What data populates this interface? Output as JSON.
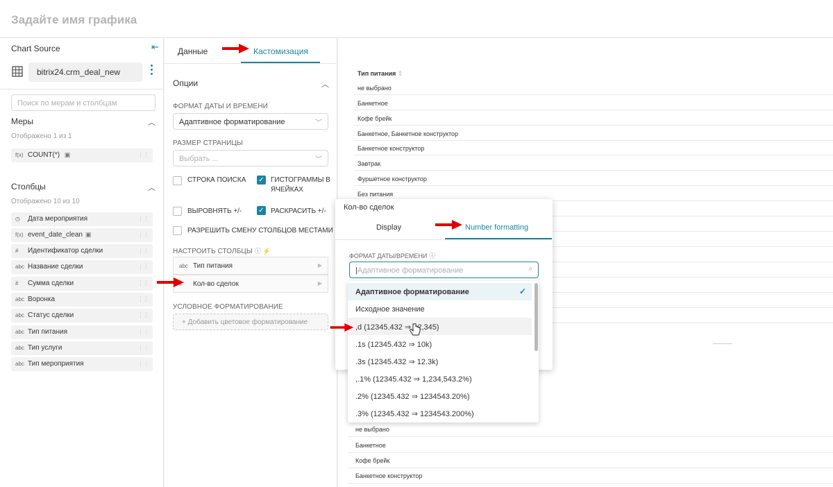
{
  "header": {
    "title": "Задайте имя графика"
  },
  "left": {
    "section_title": "Chart Source",
    "datasource": "bitrix24.crm_deal_new",
    "search_placeholder": "Поиск по мерам и столбцам",
    "measures": {
      "title": "Меры",
      "subtitle": "Отображено 1 из 1",
      "items": [
        {
          "type": "f(x)",
          "name": "COUNT(*)"
        }
      ]
    },
    "columns": {
      "title": "Столбцы",
      "subtitle": "Отображено 10 из 10",
      "items": [
        {
          "type": "clock",
          "name": "Дата мероприятия"
        },
        {
          "type": "f(x)",
          "name": "event_date_clean"
        },
        {
          "type": "#",
          "name": "Идентификатор сделки"
        },
        {
          "type": "abc",
          "name": "Название сделки"
        },
        {
          "type": "#",
          "name": "Сумма сделки"
        },
        {
          "type": "abc",
          "name": "Воронка"
        },
        {
          "type": "abc",
          "name": "Статус сделки"
        },
        {
          "type": "abc",
          "name": "Тип питания"
        },
        {
          "type": "abc",
          "name": "Тип услуги"
        },
        {
          "type": "abc",
          "name": "Тип мероприятия"
        }
      ]
    }
  },
  "middle": {
    "tabs": [
      {
        "label": "Данные"
      },
      {
        "label": "Кастомизация"
      }
    ],
    "options_title": "Опции",
    "date_format_label": "ФОРМАТ ДАТЫ И ВРЕМЕНИ",
    "date_format_value": "Адаптивное форматирование",
    "page_size_label": "РАЗМЕР СТРАНИЦЫ",
    "page_size_placeholder": "Выбрать ...",
    "checkboxes": [
      {
        "label": "СТРОКА ПОИСКА",
        "checked": false
      },
      {
        "label": "ГИСТОГРАММЫ В ЯЧЕЙКАХ",
        "checked": true
      },
      {
        "label": "ВЫРОВНЯТЬ +/-",
        "checked": false
      },
      {
        "label": "РАСКРАСИТЬ +/-",
        "checked": true
      },
      {
        "label": "РАЗРЕШИТЬ СМЕНУ СТОЛБЦОВ МЕСТАМИ",
        "checked": false
      }
    ],
    "columns_config_label": "НАСТРОИТЬ СТОЛБЦЫ",
    "column_items": [
      {
        "type": "abc",
        "name": "Тип питания"
      },
      {
        "type": "#",
        "name": "Кол-во сделок"
      }
    ],
    "conditional_label": "УСЛОВНОЕ ФОРМАТИРОВАНИЕ",
    "add_color_button": "+ Добавить цветовое форматирование"
  },
  "table": {
    "header": "Тип питания",
    "rows": [
      "не выбрано",
      "Банкетное",
      "Кофе брейк",
      "Банкетное, Банкетное конструктор",
      "Банкетное конструктор",
      "Завтрак",
      "Фуршетное конструктор",
      "Без питания"
    ],
    "bottom_rows": [
      "не выбрано",
      "Банкетное",
      "Кофе брейк",
      "Банкетное конструктор"
    ]
  },
  "popup": {
    "title": "Кол-во сделок",
    "tabs": [
      {
        "label": "Display"
      },
      {
        "label": "Number formatting"
      }
    ],
    "format_label": "ФОРМАТ ДАТЫ/ВРЕМЕНИ",
    "input_placeholder": "Адаптивное форматирование",
    "options": [
      "Адаптивное форматирование",
      "Исходное значение",
      ",d (12345.432 ⇒ 12,345)",
      ".1s (12345.432 ⇒ 10k)",
      ".3s (12345.432 ⇒ 12.3k)",
      ",.1% (12345.432 ⇒ 1,234,543.2%)",
      ".2% (12345.432 ⇒ 1234543.20%)",
      ".3% (12345.432 ⇒ 1234543.200%)"
    ],
    "selected_index": 0
  },
  "colors": {
    "accent": "#1a85a0",
    "arrow": "#e00000"
  }
}
